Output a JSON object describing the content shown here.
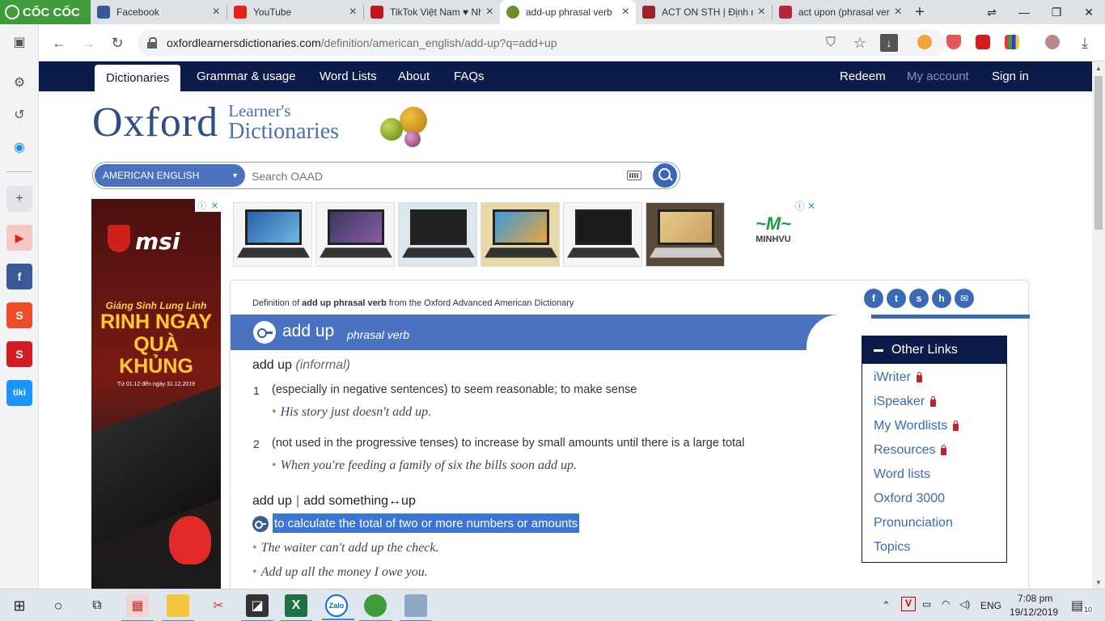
{
  "browser": {
    "brand": "CỐC CỐC",
    "tabs": [
      {
        "title": "Facebook",
        "color": "#3b5998",
        "active": false
      },
      {
        "title": "YouTube",
        "color": "#e62117",
        "active": false
      },
      {
        "title": "TikTok Việt Nam ♥ Nh",
        "color": "#c3161c",
        "active": false
      },
      {
        "title": "add-up phrasal verb",
        "color": "#6b8f2a",
        "active": true
      },
      {
        "title": "ACT ON STH | Định n",
        "color": "#9b2226",
        "active": false
      },
      {
        "title": "act upon (phrasal ver",
        "color": "#b5263a",
        "active": false
      }
    ],
    "url_host": "oxfordlearnersdictionaries.com",
    "url_path": "/definition/american_english/add-up?q=add+up"
  },
  "site_nav": {
    "items": [
      "Dictionaries",
      "Grammar & usage",
      "Word Lists",
      "About",
      "FAQs"
    ],
    "right": [
      "Redeem",
      "My account",
      "Sign in"
    ]
  },
  "logo": {
    "word": "Oxford",
    "line1": "Learner's",
    "line2": "Dictionaries"
  },
  "search": {
    "dictionary": "AMERICAN ENGLISH",
    "placeholder": "Search OAAD"
  },
  "left_ad": {
    "brand": "msi",
    "promo_line1": "Giáng Sinh Lung Linh",
    "promo_line2": "RINH NGAY",
    "promo_line3": "QUÀ KHỦNG",
    "promo_dates": "Từ 01.12 đến ngày 31.12.2019"
  },
  "top_ad": {
    "advertiser": "MINHVU"
  },
  "entry": {
    "source_prefix": "Definition of ",
    "source_bold": "add up phrasal verb",
    "source_suffix": " from the Oxford Advanced American Dictionary",
    "headword": "add up",
    "pos": "phrasal verb",
    "sense_group1": {
      "phrase": "add up",
      "label": "(informal)"
    },
    "senses": [
      {
        "num": "1",
        "def": "(especially in negative sentences) to seem reasonable; to make sense",
        "example": "His story just doesn't add up."
      },
      {
        "num": "2",
        "def": "(not used in the progressive tenses) to increase by small amounts until there is a large total",
        "example": "When you're feeding a family of six the bills soon add up."
      }
    ],
    "sense_group2": {
      "phrase1": "add up",
      "sep": "|",
      "phrase2": "add something↔up"
    },
    "highlight_def": "to calculate the total of two or more numbers or amounts",
    "examples2": [
      "The waiter can't add up the check.",
      "Add up all the money I owe you."
    ]
  },
  "other_links": {
    "title": "Other Links",
    "items": [
      {
        "label": "iWriter",
        "locked": true
      },
      {
        "label": "iSpeaker",
        "locked": true
      },
      {
        "label": "My Wordlists",
        "locked": true
      },
      {
        "label": "Resources",
        "locked": true
      },
      {
        "label": "Word lists",
        "locked": false
      },
      {
        "label": "Oxford 3000",
        "locked": false
      },
      {
        "label": "Pronunciation",
        "locked": false
      },
      {
        "label": "Topics",
        "locked": false
      }
    ]
  },
  "taskbar": {
    "lang": "ENG",
    "time": "7:08 pm",
    "date": "19/12/2019",
    "notif_count": "10"
  }
}
